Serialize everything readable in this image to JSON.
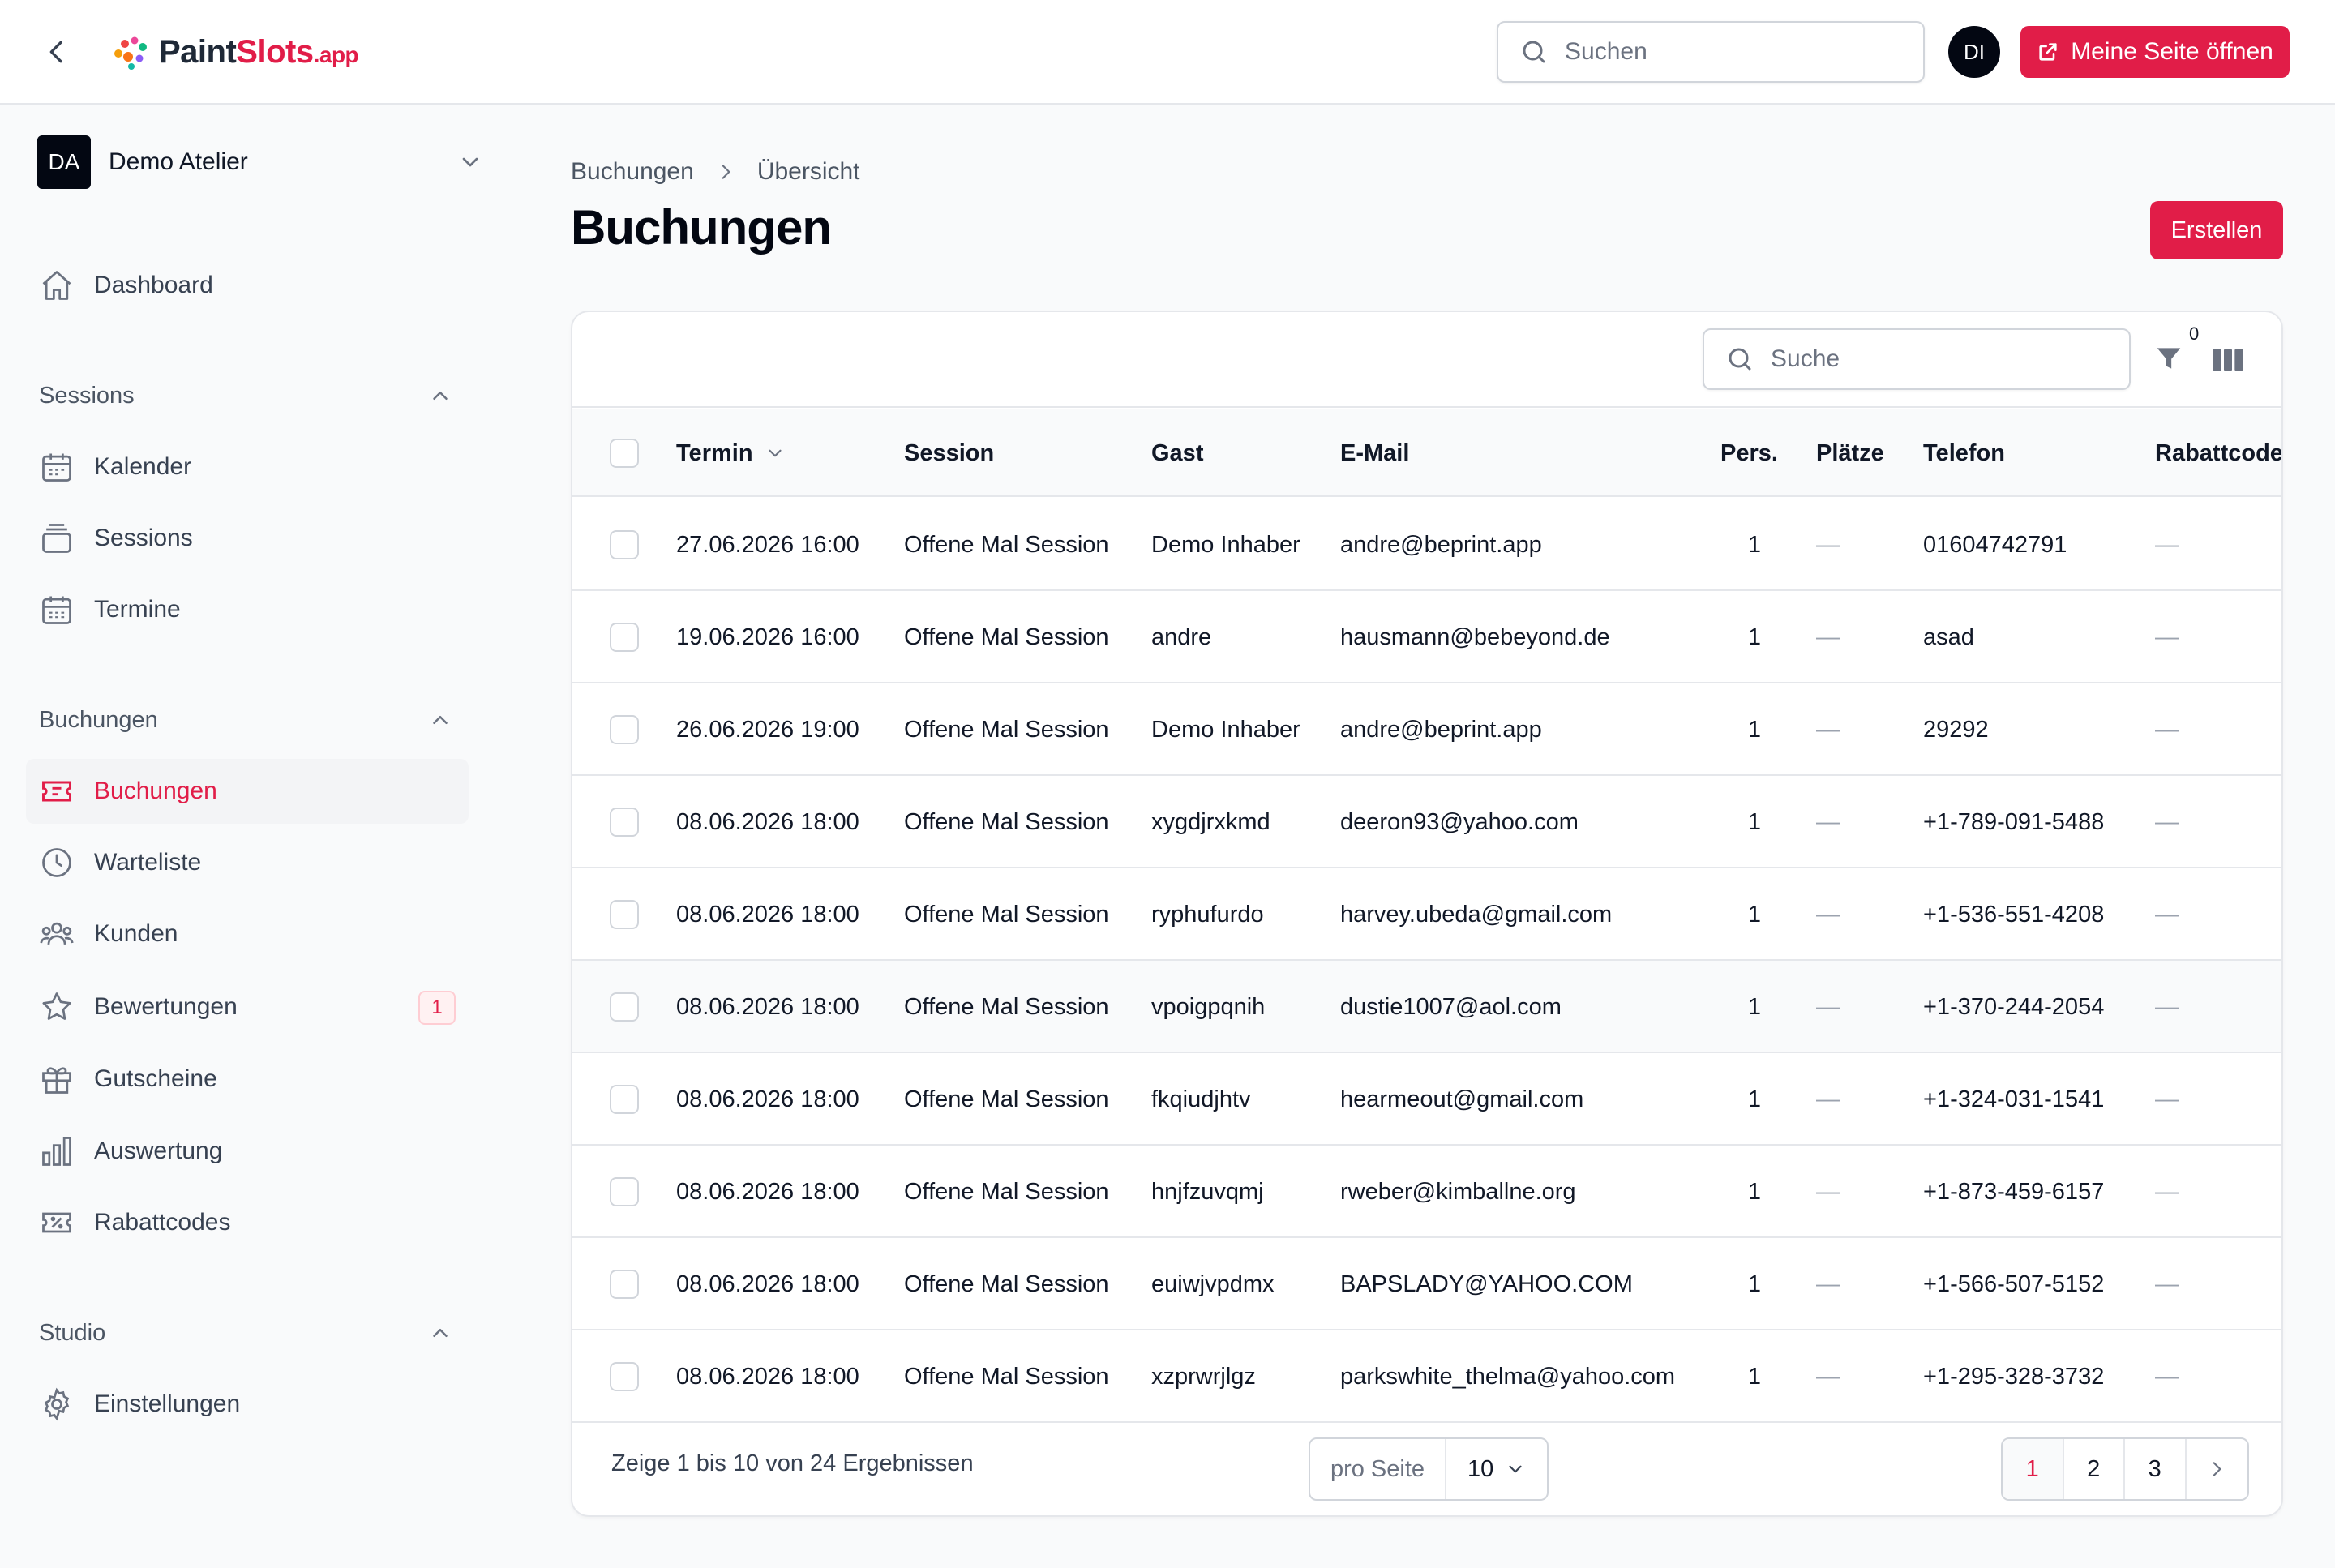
{
  "header": {
    "brand": {
      "name_main": "Paint",
      "name_accent": "Slots",
      "name_suffix": ".app"
    },
    "search_placeholder": "Suchen",
    "user_initials": "DI",
    "open_page_label": "Meine Seite öffnen"
  },
  "sidebar": {
    "tenant": {
      "initials": "DA",
      "name": "Demo Atelier"
    },
    "dashboard": "Dashboard",
    "groups": {
      "sessions": {
        "label": "Sessions",
        "items": [
          "Kalender",
          "Sessions",
          "Termine"
        ]
      },
      "buchungen": {
        "label": "Buchungen",
        "items": [
          "Buchungen",
          "Warteliste",
          "Kunden",
          "Bewertungen",
          "Gutscheine",
          "Auswertung",
          "Rabattcodes"
        ],
        "badge_bewertungen": "1"
      },
      "studio": {
        "label": "Studio",
        "items": [
          "Einstellungen"
        ]
      }
    }
  },
  "main": {
    "breadcrumb": [
      "Buchungen",
      "Übersicht"
    ],
    "title": "Buchungen",
    "create_label": "Erstellen",
    "table": {
      "search_placeholder": "Suche",
      "filter_count": "0",
      "columns": [
        "Termin",
        "Session",
        "Gast",
        "E-Mail",
        "Pers.",
        "Plätze",
        "Telefon",
        "Rabattcode"
      ],
      "rows": [
        [
          "27.06.2026 16:00",
          "Offene Mal Session",
          "Demo Inhaber",
          "andre@beprint.app",
          "1",
          "—",
          "01604742791",
          "—"
        ],
        [
          "19.06.2026 16:00",
          "Offene Mal Session",
          "andre",
          "hausmann@bebeyond.de",
          "1",
          "—",
          "asad",
          "—"
        ],
        [
          "26.06.2026 19:00",
          "Offene Mal Session",
          "Demo Inhaber",
          "andre@beprint.app",
          "1",
          "—",
          "29292",
          "—"
        ],
        [
          "08.06.2026 18:00",
          "Offene Mal Session",
          "xygdjrxkmd",
          "deeron93@yahoo.com",
          "1",
          "—",
          "+1-789-091-5488",
          "—"
        ],
        [
          "08.06.2026 18:00",
          "Offene Mal Session",
          "ryphufurdo",
          "harvey.ubeda@gmail.com",
          "1",
          "—",
          "+1-536-551-4208",
          "—"
        ],
        [
          "08.06.2026 18:00",
          "Offene Mal Session",
          "vpoigpqnih",
          "dustie1007@aol.com",
          "1",
          "—",
          "+1-370-244-2054",
          "—"
        ],
        [
          "08.06.2026 18:00",
          "Offene Mal Session",
          "fkqiudjhtv",
          "hearmeout@gmail.com",
          "1",
          "—",
          "+1-324-031-1541",
          "—"
        ],
        [
          "08.06.2026 18:00",
          "Offene Mal Session",
          "hnjfzuvqmj",
          "rweber@kimballne.org",
          "1",
          "—",
          "+1-873-459-6157",
          "—"
        ],
        [
          "08.06.2026 18:00",
          "Offene Mal Session",
          "euiwjvpdmx",
          "BAPSLADY@YAHOO.COM",
          "1",
          "—",
          "+1-566-507-5152",
          "—"
        ],
        [
          "08.06.2026 18:00",
          "Offene Mal Session",
          "xzprwrjlgz",
          "parkswhite_thelma@yahoo.com",
          "1",
          "—",
          "+1-295-328-3732",
          "—"
        ]
      ]
    },
    "footer": {
      "results_text": "Zeige 1 bis 10 von 24 Ergebnissen",
      "per_page_label": "pro Seite",
      "per_page_value": "10",
      "pages": [
        "1",
        "2",
        "3"
      ],
      "current_page": "1"
    }
  },
  "colors": {
    "accent": "#e11d48",
    "dark": "#030712",
    "border": "#e5e7eb",
    "muted": "#6b7280"
  },
  "icons": {
    "back": "chevron-left-icon",
    "search": "search-icon",
    "external": "external-link-icon",
    "filter": "funnel-icon",
    "columns": "columns-icon"
  }
}
